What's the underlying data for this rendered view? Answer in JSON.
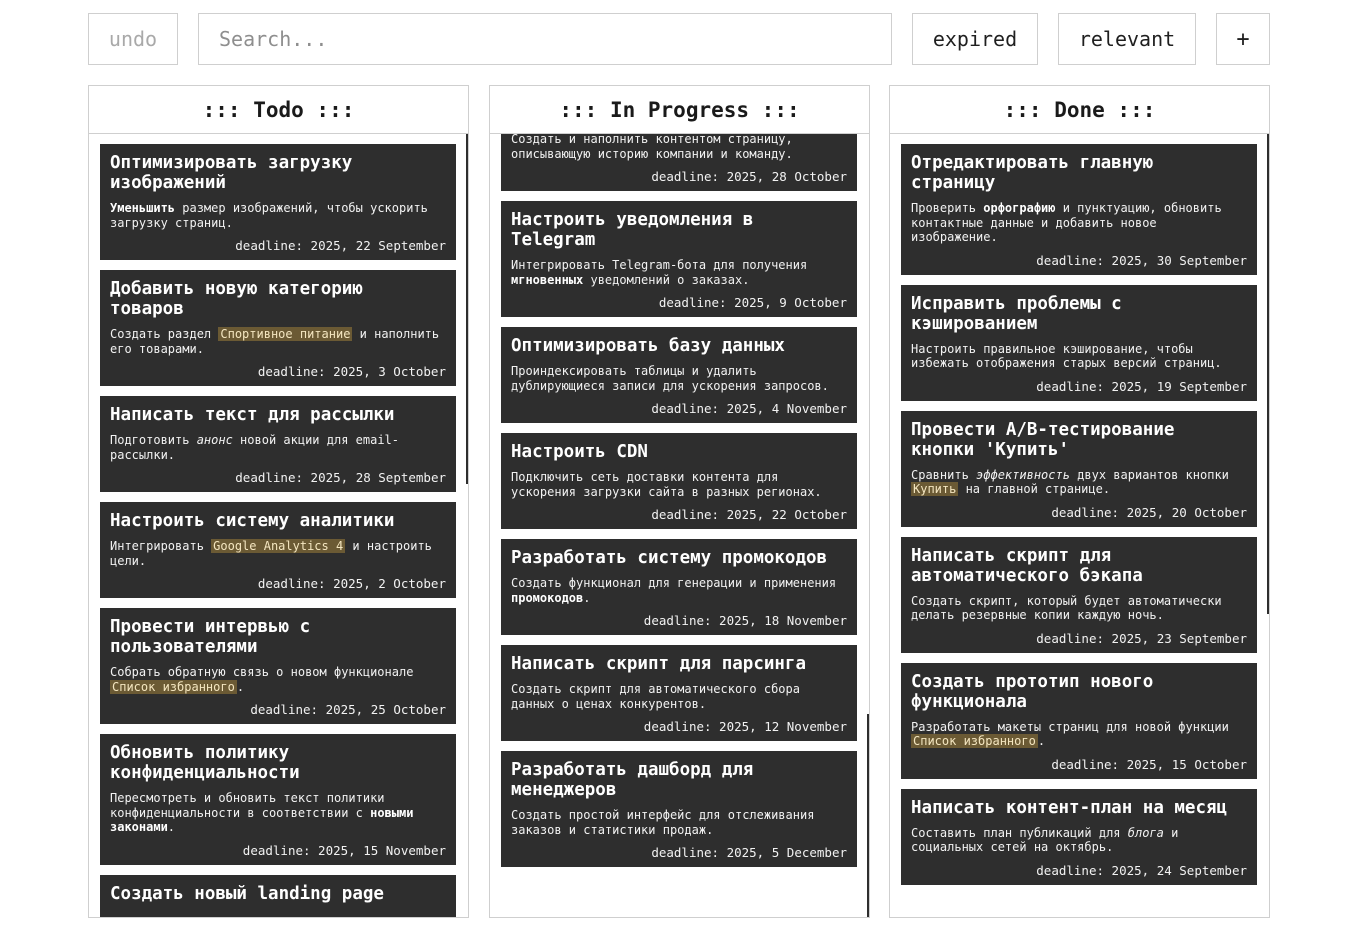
{
  "toolbar": {
    "undo_label": "undo",
    "search_placeholder": "Search...",
    "search_value": "",
    "expired_label": "expired",
    "relevant_label": "relevant",
    "add_label": "+"
  },
  "colors": {
    "card_bg": "#2e2e2e",
    "highlight_bg": "#6b5a34",
    "border": "#cfcfcf"
  },
  "columns": [
    {
      "title": "::: Todo :::",
      "cards": [
        {
          "title": "Оптимизировать загрузку изображений",
          "desc": [
            {
              "t": "Уменьшить",
              "s": "b"
            },
            {
              "t": " размер изображений, чтобы ускорить загрузку страниц."
            }
          ],
          "deadline": "deadline: 2025, 22 September"
        },
        {
          "title": "Добавить новую категорию товаров",
          "desc": [
            {
              "t": "Создать раздел "
            },
            {
              "t": "Спортивное питание",
              "s": "hl"
            },
            {
              "t": " и наполнить его товарами."
            }
          ],
          "deadline": "deadline: 2025, 3 October"
        },
        {
          "title": "Написать текст для рассылки",
          "desc": [
            {
              "t": "Подготовить "
            },
            {
              "t": "анонс",
              "s": "i"
            },
            {
              "t": " новой акции для email-рассылки."
            }
          ],
          "deadline": "deadline: 2025, 28 September"
        },
        {
          "title": "Настроить систему аналитики",
          "desc": [
            {
              "t": "Интегрировать "
            },
            {
              "t": "Google Analytics 4",
              "s": "hl"
            },
            {
              "t": " и настроить цели."
            }
          ],
          "deadline": "deadline: 2025, 2 October"
        },
        {
          "title": "Провести интервью с пользователями",
          "desc": [
            {
              "t": "Собрать обратную связь о новом функционале "
            },
            {
              "t": "Список избранного",
              "s": "hl"
            },
            {
              "t": "."
            }
          ],
          "deadline": "deadline: 2025, 25 October"
        },
        {
          "title": "Обновить политику конфиденциальности",
          "desc": [
            {
              "t": "Пересмотреть и обновить текст политики конфиденциальности в соответствии с "
            },
            {
              "t": "новыми законами",
              "s": "b"
            },
            {
              "t": "."
            }
          ],
          "deadline": "deadline: 2025, 15 November"
        },
        {
          "title": "Создать новый landing page",
          "desc": [],
          "deadline": ""
        }
      ]
    },
    {
      "title": "::: In Progress :::",
      "cards": [
        {
          "title": "",
          "desc": [
            {
              "t": "Создать и наполнить контентом страницу, описывающую историю компании и команду."
            }
          ],
          "deadline": "deadline: 2025, 28 October"
        },
        {
          "title": "Настроить уведомления в Telegram",
          "desc": [
            {
              "t": "Интегрировать Telegram-бота для получения "
            },
            {
              "t": "мгновенных",
              "s": "b"
            },
            {
              "t": " уведомлений о заказах."
            }
          ],
          "deadline": "deadline: 2025, 9 October"
        },
        {
          "title": "Оптимизировать базу данных",
          "desc": [
            {
              "t": "Проиндексировать таблицы и удалить дублирующиеся записи для ускорения запросов."
            }
          ],
          "deadline": "deadline: 2025, 4 November"
        },
        {
          "title": "Настроить CDN",
          "desc": [
            {
              "t": "Подключить сеть доставки контента для ускорения загрузки сайта в разных регионах."
            }
          ],
          "deadline": "deadline: 2025, 22 October"
        },
        {
          "title": "Разработать систему промокодов",
          "desc": [
            {
              "t": "Создать функционал для генерации и применения "
            },
            {
              "t": "промокодов",
              "s": "b"
            },
            {
              "t": "."
            }
          ],
          "deadline": "deadline: 2025, 18 November"
        },
        {
          "title": "Написать скрипт для парсинга",
          "desc": [
            {
              "t": "Создать скрипт для автоматического сбора данных о ценах конкурентов."
            }
          ],
          "deadline": "deadline: 2025, 12 November"
        },
        {
          "title": "Разработать дашборд для менеджеров",
          "desc": [
            {
              "t": "Создать простой интерфейс для отслеживания заказов и статистики продаж."
            }
          ],
          "deadline": "deadline: 2025, 5 December"
        }
      ]
    },
    {
      "title": "::: Done :::",
      "cards": [
        {
          "title": "Отредактировать главную страницу",
          "desc": [
            {
              "t": "Проверить "
            },
            {
              "t": "орфографию",
              "s": "b"
            },
            {
              "t": " и пунктуацию, обновить контактные данные и добавить новое изображение."
            }
          ],
          "deadline": "deadline: 2025, 30 September"
        },
        {
          "title": "Исправить проблемы с кэшированием",
          "desc": [
            {
              "t": "Настроить правильное кэширование, чтобы избежать отображения старых версий страниц."
            }
          ],
          "deadline": "deadline: 2025, 19 September"
        },
        {
          "title": "Провести A/B-тестирование кнопки 'Купить'",
          "desc": [
            {
              "t": "Сравнить "
            },
            {
              "t": "эффективность",
              "s": "i"
            },
            {
              "t": " двух вариантов кнопки "
            },
            {
              "t": "Купить",
              "s": "hl"
            },
            {
              "t": " на главной странице."
            }
          ],
          "deadline": "deadline: 2025, 20 October"
        },
        {
          "title": "Написать скрипт для автоматического бэкапа",
          "desc": [
            {
              "t": "Создать скрипт, который будет автоматически делать резервные копии каждую ночь."
            }
          ],
          "deadline": "deadline: 2025, 23 September"
        },
        {
          "title": "Создать прототип нового функционала",
          "desc": [
            {
              "t": "Разработать макеты страниц для новой функции "
            },
            {
              "t": "Список избранного",
              "s": "hl"
            },
            {
              "t": "."
            }
          ],
          "deadline": "deadline: 2025, 15 October"
        },
        {
          "title": "Написать контент-план на месяц",
          "desc": [
            {
              "t": "Составить план публикаций для "
            },
            {
              "t": "блога",
              "s": "i"
            },
            {
              "t": " и социальных сетей на октябрь."
            }
          ],
          "deadline": "deadline: 2025, 24 September"
        }
      ]
    }
  ]
}
